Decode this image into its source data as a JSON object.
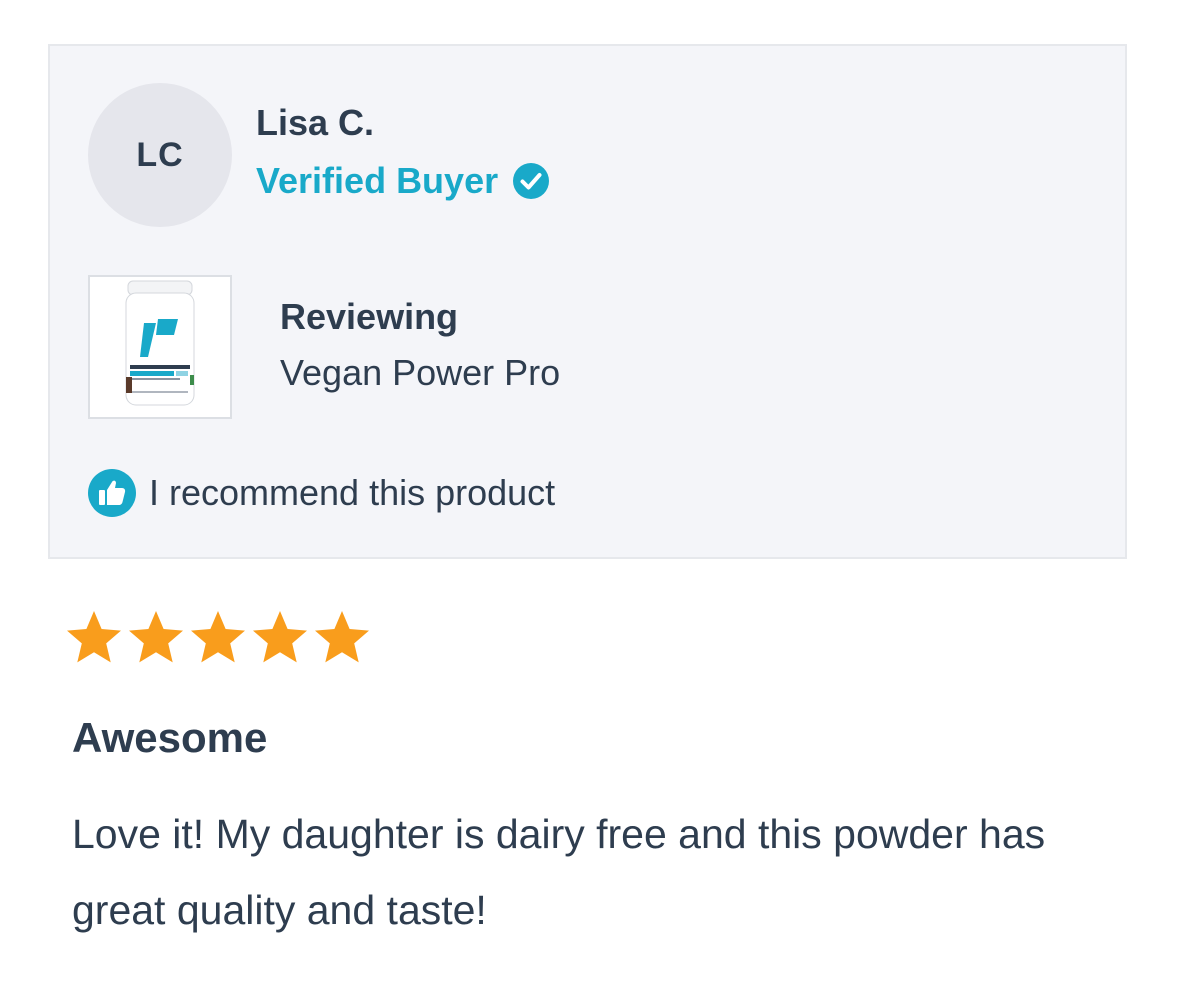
{
  "reviewer": {
    "initials": "LC",
    "name": "Lisa C.",
    "verified_label": "Verified Buyer"
  },
  "product": {
    "reviewing_label": "Reviewing",
    "name": "Vegan Power Pro",
    "image_icon": "protein-tub-icon"
  },
  "recommendation": {
    "text": "I recommend this product",
    "icon": "thumbs-up-icon"
  },
  "rating": {
    "value": 5,
    "max": 5,
    "star_color": "#f99d1c"
  },
  "review": {
    "title": "Awesome",
    "body": "Love it! My daughter is dairy free and this powder has great quality and taste!"
  },
  "colors": {
    "accent": "#19a9c9",
    "text": "#2e3d4f",
    "card_bg": "#f4f5f9"
  }
}
